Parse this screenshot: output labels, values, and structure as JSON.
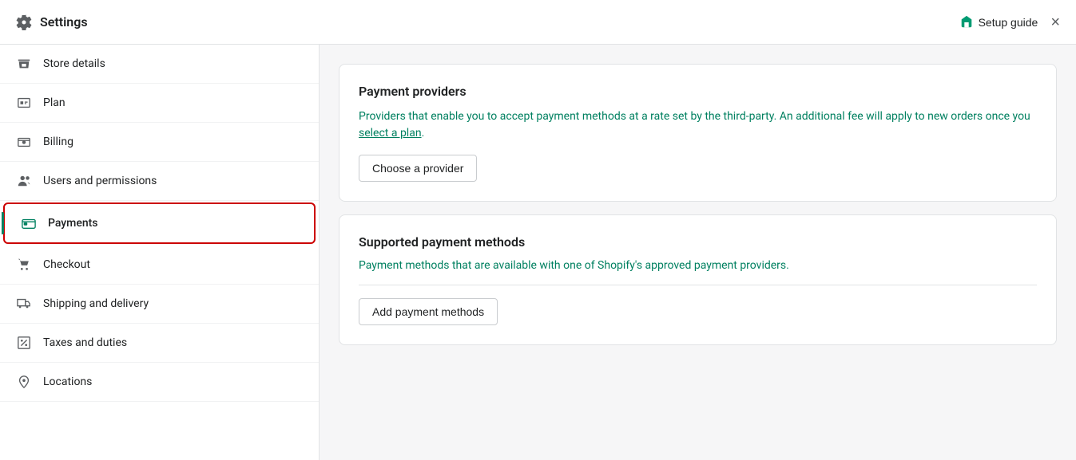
{
  "header": {
    "title": "Settings",
    "setup_guide_label": "Setup guide",
    "close_label": "×"
  },
  "sidebar": {
    "items": [
      {
        "id": "store-details",
        "label": "Store details",
        "icon": "store"
      },
      {
        "id": "plan",
        "label": "Plan",
        "icon": "plan"
      },
      {
        "id": "billing",
        "label": "Billing",
        "icon": "billing"
      },
      {
        "id": "users-permissions",
        "label": "Users and permissions",
        "icon": "users"
      },
      {
        "id": "payments",
        "label": "Payments",
        "icon": "payments",
        "active": true
      },
      {
        "id": "checkout",
        "label": "Checkout",
        "icon": "checkout"
      },
      {
        "id": "shipping-delivery",
        "label": "Shipping and delivery",
        "icon": "shipping"
      },
      {
        "id": "taxes-duties",
        "label": "Taxes and duties",
        "icon": "taxes"
      },
      {
        "id": "locations",
        "label": "Locations",
        "icon": "locations"
      }
    ]
  },
  "content": {
    "payment_providers": {
      "title": "Payment providers",
      "description_part1": "Providers that enable you to accept payment methods at a rate set by the third-party. An additional fee will apply to new orders once you ",
      "link_text": "select a plan",
      "description_part2": ".",
      "choose_provider_btn": "Choose a provider"
    },
    "supported_payment_methods": {
      "title": "Supported payment methods",
      "subtitle": "Payment methods that are available with one of Shopify's approved payment providers.",
      "add_btn": "Add payment methods"
    }
  }
}
